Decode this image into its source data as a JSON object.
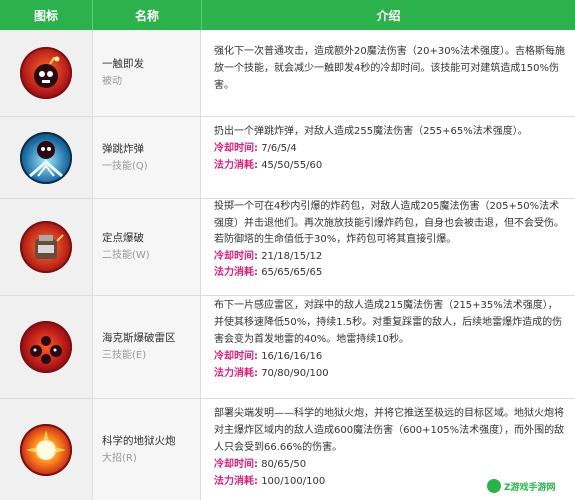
{
  "header": {
    "icon": "图标",
    "name": "名称",
    "desc": "介绍"
  },
  "colors": {
    "header": "#2bb24c",
    "label": "#d4237a"
  },
  "rows": [
    {
      "icon": "bomb-passive-icon",
      "name": "一触即发",
      "type": "被动",
      "desc": "强化下一次普通攻击，造成额外20魔法伤害（20+30%法术强度）。吉格斯每施放一个技能，就会减少一触即发4秒的冷却时间。该技能可对建筑造成150%伤害。",
      "cooldown_label": "",
      "cooldown": "",
      "cost_label": "",
      "cost": ""
    },
    {
      "icon": "bouncing-bomb-icon",
      "name": "弹跳炸弹",
      "type": "一技能(Q)",
      "desc": "扔出一个弹跳炸弹，对敌人造成255魔法伤害（255+65%法术强度）。",
      "cooldown_label": "冷却时间:",
      "cooldown": "7/6/5/4",
      "cost_label": "法力消耗:",
      "cost": "45/50/55/60"
    },
    {
      "icon": "satchel-charge-icon",
      "name": "定点爆破",
      "type": "二技能(W)",
      "desc": "投掷一个可在4秒内引爆的炸药包，对敌人造成205魔法伤害（205+50%法术强度）并击退他们。再次施放技能引爆炸药包，自身也会被击退，但不会受伤。若防御塔的生命值低于30%，炸药包可将其直接引爆。",
      "cooldown_label": "冷却时间:",
      "cooldown": "21/18/15/12",
      "cost_label": "法力消耗:",
      "cost": "65/65/65/65"
    },
    {
      "icon": "minefield-icon",
      "name": "海克斯爆破雷区",
      "type": "三技能(E)",
      "desc": "布下一片感应雷区，对踩中的敌人造成215魔法伤害（215+35%法术强度），并使其移速降低50%，持续1.5秒。对重复踩雷的敌人，后续地雷爆炸造成的伤害会变为首发地雷的40%。地雷持续10秒。",
      "cooldown_label": "冷却时间:",
      "cooldown": "16/16/16/16",
      "cost_label": "法力消耗:",
      "cost": "70/80/90/100"
    },
    {
      "icon": "mega-inferno-bomb-icon",
      "name": "科学的地狱火炮",
      "type": "大招(R)",
      "desc": "部署尖端发明——科学的地狱火炮，并将它推送至极远的目标区域。地狱火炮将对主爆炸区域内的敌人造成600魔法伤害（600+105%法术强度），而外围的敌人只会受到66.66%的伤害。",
      "cooldown_label": "冷却时间:",
      "cooldown": "80/65/50",
      "cost_label": "法力消耗:",
      "cost": "100/100/100"
    }
  ],
  "watermark": {
    "text": "Z游戏手游网"
  }
}
